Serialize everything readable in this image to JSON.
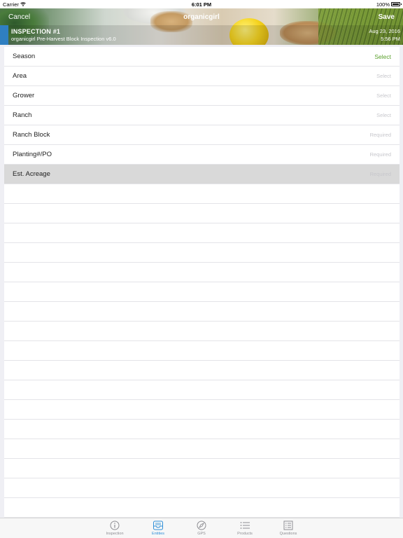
{
  "status_bar": {
    "carrier": "Carrier",
    "time": "6:01 PM",
    "battery": "100%"
  },
  "nav": {
    "cancel_label": "Cancel",
    "title": "organicgirl",
    "save_label": "Save"
  },
  "inspection": {
    "title": "INSPECTION #1",
    "subtitle": "organicgirl Pre-Harvest Block Inspection v6.0",
    "date": "Aug 23, 2016",
    "time": "5:56 PM",
    "accent_color": "#2f7fc1"
  },
  "fields": [
    {
      "label": "Season",
      "value": "Select"
    },
    {
      "label": "Area",
      "value": "Select"
    },
    {
      "label": "Grower",
      "value": "Select"
    },
    {
      "label": "Ranch",
      "value": "Select"
    },
    {
      "label": "Ranch Block",
      "value": "Required"
    },
    {
      "label": "Planting#/PO",
      "value": "Required"
    },
    {
      "label": "Est. Acreage",
      "value": "Required"
    }
  ],
  "tabs": [
    {
      "label": "Inspection",
      "icon": "info-icon"
    },
    {
      "label": "Entities",
      "icon": "inbox-icon"
    },
    {
      "label": "GPS",
      "icon": "compass-icon"
    },
    {
      "label": "Products",
      "icon": "list-icon"
    },
    {
      "label": "Questions",
      "icon": "checklist-icon"
    }
  ],
  "colors": {
    "active_tab": "#2f8fd8",
    "select_value": "#5aa02c",
    "selected_row": "#d9d9d9"
  }
}
